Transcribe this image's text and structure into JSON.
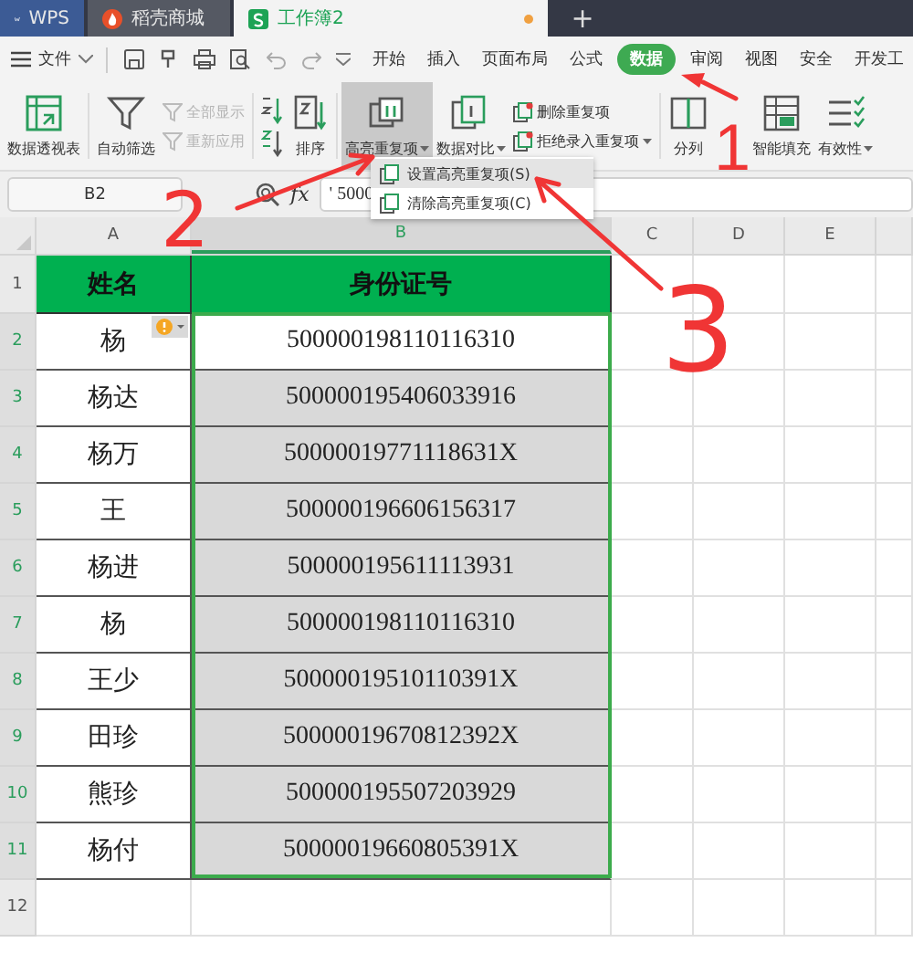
{
  "title_bar": {
    "tabs": [
      {
        "label": "WPS",
        "kind": "home",
        "selected": false,
        "modified": false
      },
      {
        "label": "稻壳商城",
        "kind": "store",
        "selected": false,
        "modified": false
      },
      {
        "label": "工作簿2",
        "kind": "sheet",
        "selected": true,
        "modified": true
      }
    ],
    "new_tab": "+"
  },
  "menu_bar": {
    "file": "文件",
    "items": [
      {
        "label": "开始",
        "selected": false
      },
      {
        "label": "插入",
        "selected": false
      },
      {
        "label": "页面布局",
        "selected": false
      },
      {
        "label": "公式",
        "selected": false
      },
      {
        "label": "数据",
        "selected": true
      },
      {
        "label": "审阅",
        "selected": false
      },
      {
        "label": "视图",
        "selected": false
      },
      {
        "label": "安全",
        "selected": false
      },
      {
        "label": "开发工",
        "selected": false
      }
    ]
  },
  "ribbon": {
    "groups": [
      [
        {
          "kind": "large",
          "label": "数据透视表",
          "pressed": false
        }
      ],
      [
        {
          "kind": "large",
          "label": "自动筛选",
          "pressed": false
        },
        {
          "kind": "stack",
          "items": [
            {
              "label": "全部显示",
              "disabled": true
            },
            {
              "label": "重新应用",
              "disabled": true
            }
          ]
        }
      ],
      [
        {
          "kind": "sort"
        },
        {
          "kind": "large",
          "label": "排序",
          "pressed": false
        }
      ],
      [
        {
          "kind": "large",
          "label": "高亮重复项",
          "dropdown": true,
          "pressed": true
        },
        {
          "kind": "large",
          "label": "数据对比",
          "dropdown": true,
          "pressed": false
        },
        {
          "kind": "stack",
          "items": [
            {
              "label": "删除重复项",
              "disabled": false
            },
            {
              "label": "拒绝录入重复项",
              "disabled": false,
              "dropdown": true
            }
          ]
        }
      ],
      [
        {
          "kind": "large",
          "label": "分列",
          "pressed": false
        },
        {
          "kind": "large",
          "label": "智能填充",
          "pressed": false
        },
        {
          "kind": "large",
          "label": "有效性",
          "dropdown": true,
          "pressed": false
        }
      ]
    ]
  },
  "dropdown_menu": [
    {
      "label": "设置高亮重复项(S)",
      "selected": true
    },
    {
      "label": "清除高亮重复项(C)",
      "selected": false
    }
  ],
  "formula_bar": {
    "name_box": "B2",
    "fx": "fx",
    "value": "' 5000"
  },
  "sheet": {
    "columns": [
      {
        "label": "A",
        "selected": false
      },
      {
        "label": "B",
        "selected": true
      },
      {
        "label": "C",
        "selected": false
      },
      {
        "label": "D",
        "selected": false
      },
      {
        "label": "E",
        "selected": false
      }
    ],
    "header": [
      "姓名",
      "身份证号"
    ],
    "rows": [
      {
        "number": "2",
        "name": "杨",
        "id": "500000198110116310",
        "highlighted": false,
        "warning": true
      },
      {
        "number": "3",
        "name": "杨达",
        "id": "500000195406033916",
        "highlighted": true
      },
      {
        "number": "4",
        "name": "杨万",
        "id": "50000019771118631X",
        "highlighted": true
      },
      {
        "number": "5",
        "name": "王",
        "id": "500000196606156317",
        "highlighted": true
      },
      {
        "number": "6",
        "name": "杨进",
        "id": "500000195611113931",
        "highlighted": true
      },
      {
        "number": "7",
        "name": "杨",
        "id": "500000198110116310",
        "highlighted": true
      },
      {
        "number": "8",
        "name": "王少",
        "id": "50000019510110391X",
        "highlighted": true
      },
      {
        "number": "9",
        "name": "田珍",
        "id": "50000019670812392X",
        "highlighted": true
      },
      {
        "number": "10",
        "name": "熊珍",
        "id": "500000195507203929",
        "highlighted": true
      },
      {
        "number": "11",
        "name": "杨付",
        "id": "50000019660805391X",
        "highlighted": true
      }
    ],
    "header_row_number": "1",
    "empty_rows": [
      "12"
    ]
  },
  "annotations": [
    "1",
    "2",
    "3"
  ]
}
